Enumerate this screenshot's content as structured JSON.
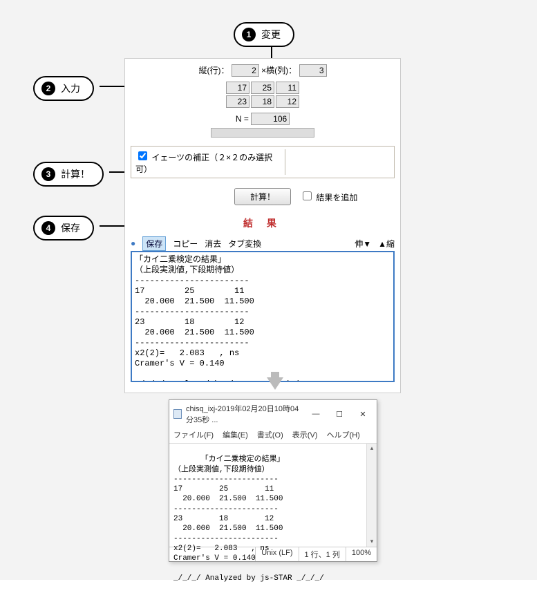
{
  "callouts": {
    "c1": "変更",
    "c2": "入力",
    "c3": "計算！",
    "c4": "保存"
  },
  "dims": {
    "row_label": "縦(行)：",
    "col_label": "×横(列)：",
    "rows": "2",
    "cols": "3"
  },
  "grid": {
    "r0c0": "17",
    "r0c1": "25",
    "r0c2": "11",
    "r1c0": "23",
    "r1c1": "18",
    "r1c2": "12"
  },
  "n": {
    "label": "N =",
    "value": "106"
  },
  "yates": {
    "label": "イェーツの補正（２×２のみ選択可）"
  },
  "calc": {
    "button": "計算！",
    "append": "結果を追加"
  },
  "result_heading": "結 果",
  "toolbar": {
    "save": "保存",
    "copy": "コピー",
    "clear": "消去",
    "tab": "タブ変換",
    "expand": "伸▼",
    "shrink": "▲縮"
  },
  "result_text": "「カイ二乗検定の結果」\n（上段実測値,下段期待値）\n-----------------------\n17        25        11\n  20.000  21.500  11.500\n-----------------------\n23        18        12\n  20.000  21.500  11.500\n-----------------------\nx2(2)=   2.083   , ns\nCramer's V = 0.140\n\n_/_/_/ Analyzed by js-STAR _/_/_/\n",
  "editor": {
    "title": "chisq_ixj-2019年02月20日10時04分35秒 ...",
    "menu": {
      "file": "ファイル(F)",
      "edit": "編集(E)",
      "format": "書式(O)",
      "view": "表示(V)",
      "help": "ヘルプ(H)"
    },
    "body": "「カイ二乗検定の結果」\n（上段実測値,下段期待値）\n-----------------------\n17        25        11\n  20.000  21.500  11.500\n-----------------------\n23        18        12\n  20.000  21.500  11.500\n-----------------------\nx2(2)=   2.083   , ns\nCramer's V = 0.140\n\n_/_/_/ Analyzed by js-STAR _/_/_/\n",
    "status": {
      "encoding": "Unix (LF)",
      "pos": "1 行、1 列",
      "zoom": "100%"
    },
    "winbtn": {
      "min": "—",
      "max": "☐",
      "close": "✕"
    }
  }
}
